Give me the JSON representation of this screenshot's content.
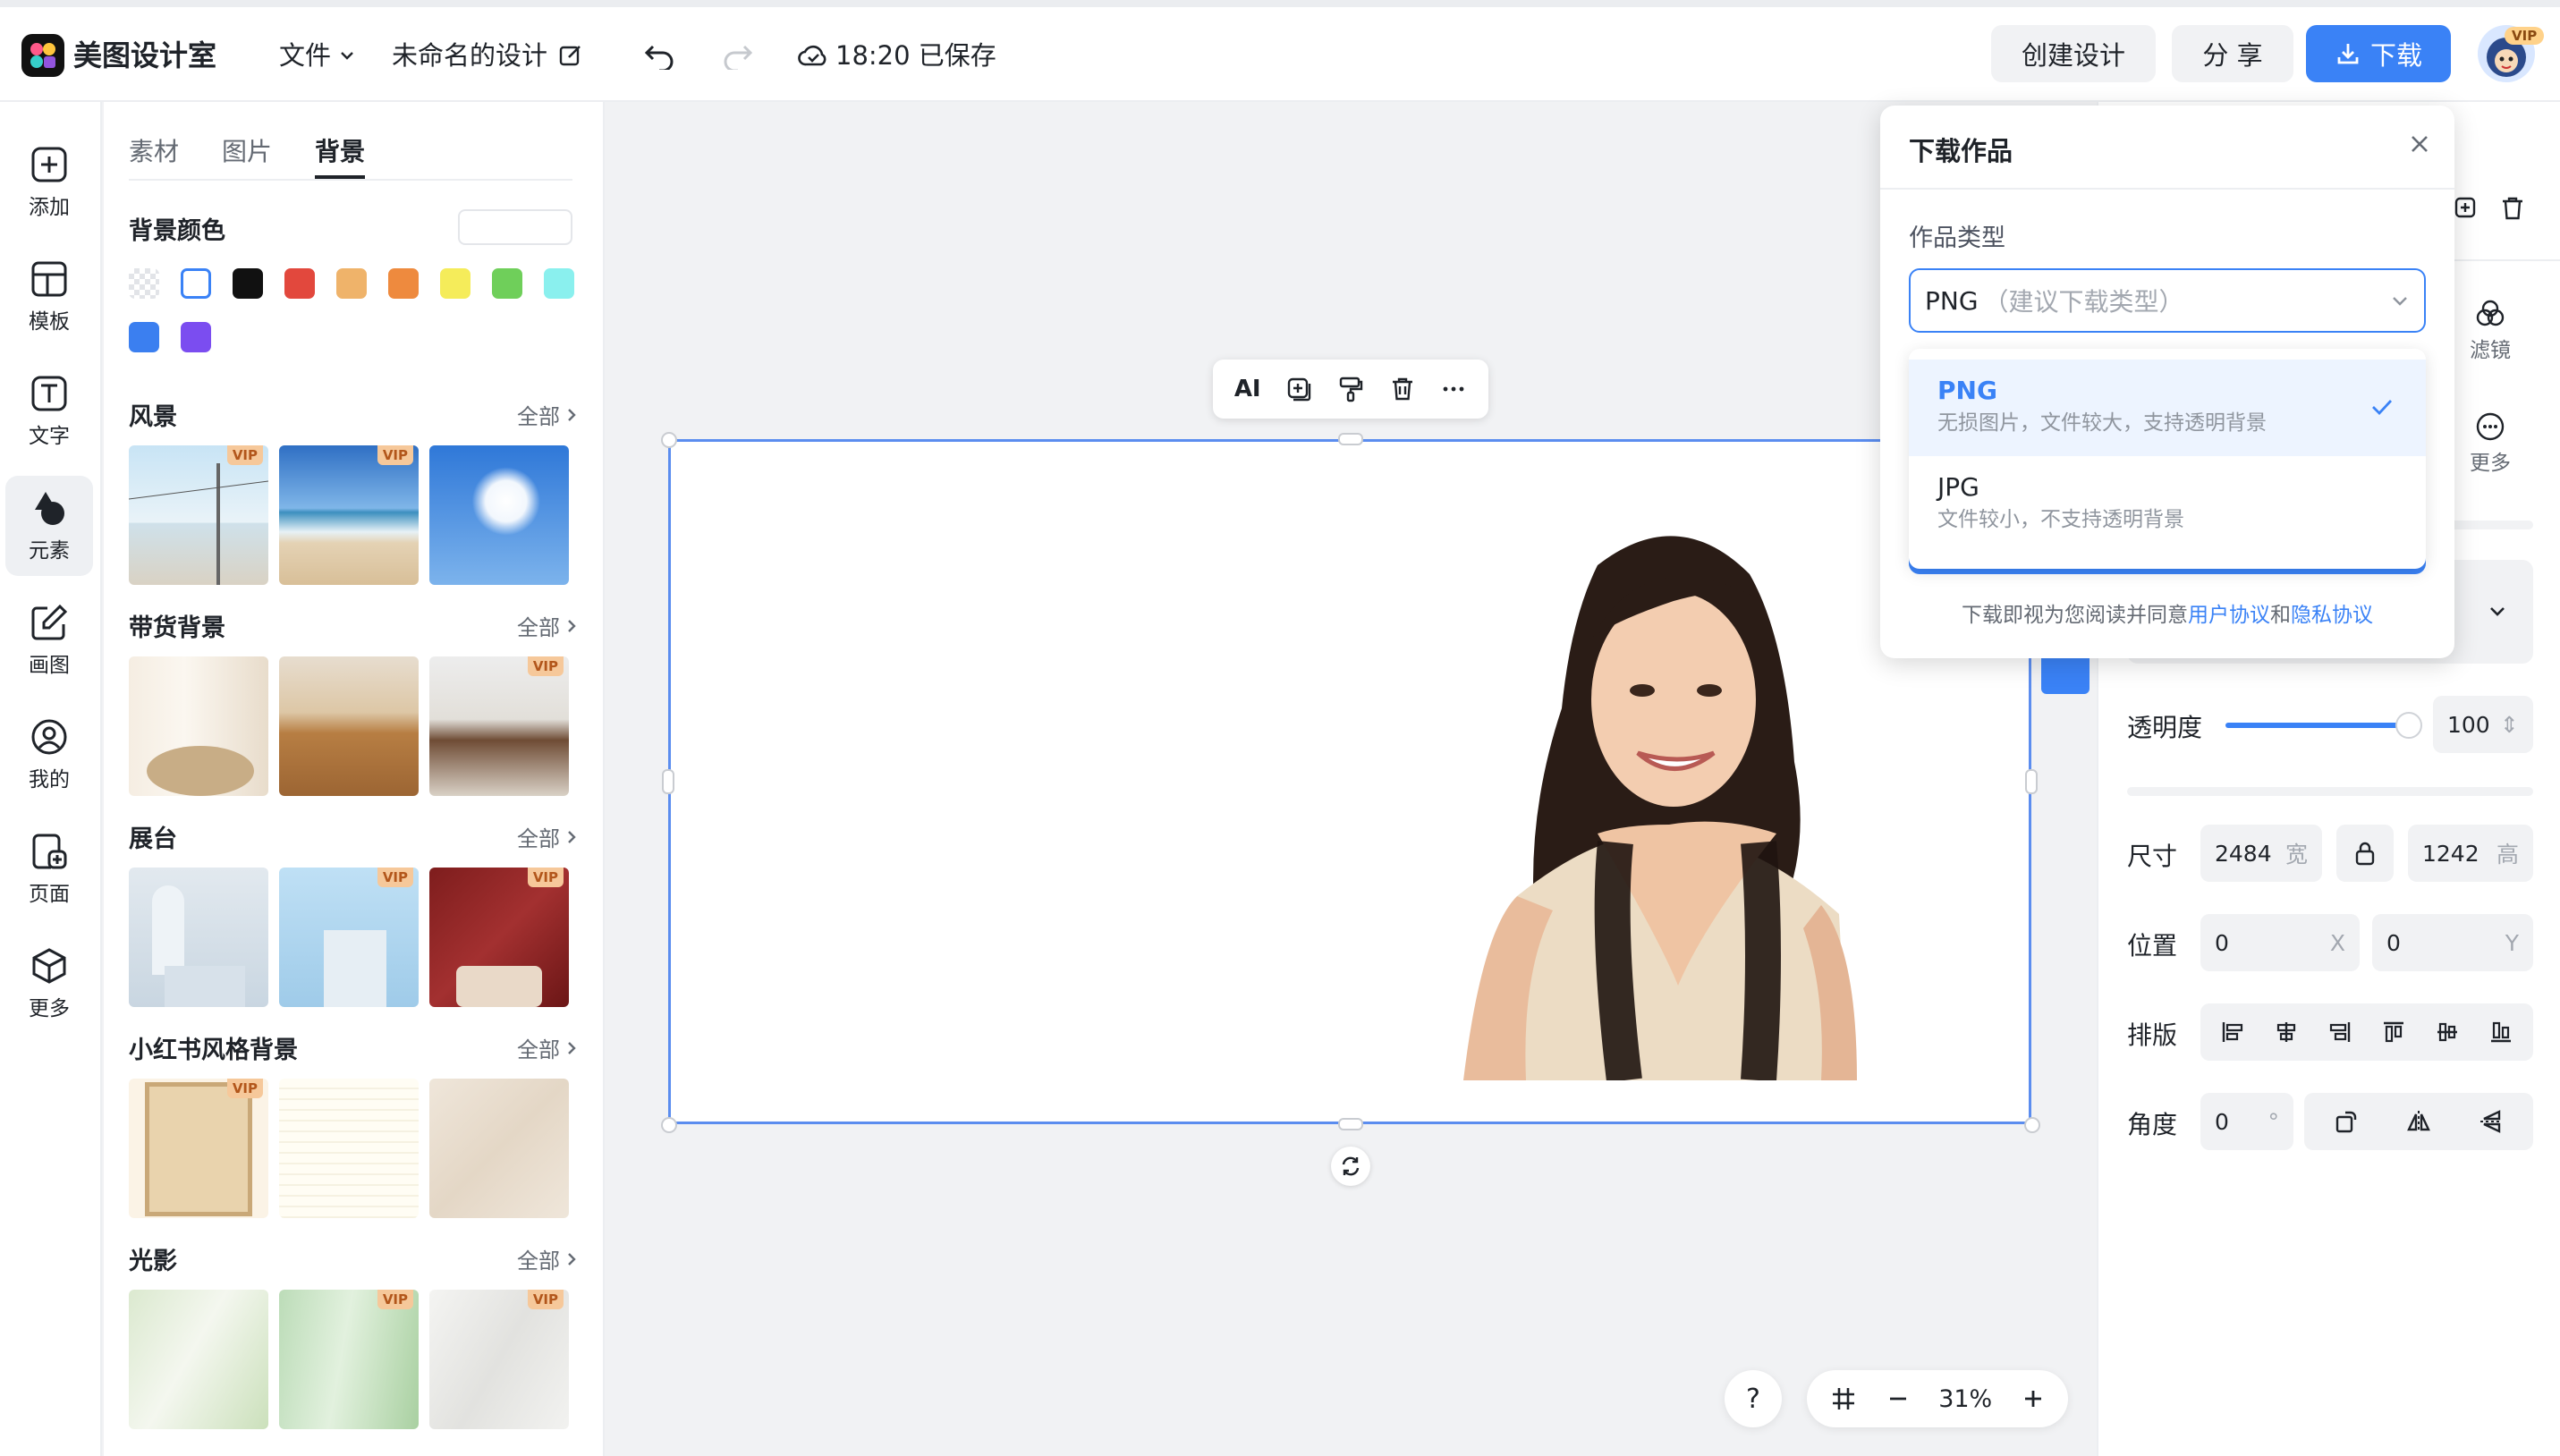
{
  "header": {
    "app_name": "美图设计室",
    "file_menu": "文件",
    "doc_title": "未命名的设计",
    "save_status": "18:20 已保存",
    "create_label": "创建设计",
    "share_label": "分 享",
    "download_label": "下载",
    "avatar_badge": "VIP"
  },
  "left_nav": {
    "items": [
      {
        "label": "添加",
        "icon": "plus-square-icon"
      },
      {
        "label": "模板",
        "icon": "template-icon"
      },
      {
        "label": "文字",
        "icon": "text-icon"
      },
      {
        "label": "元素",
        "icon": "shapes-icon"
      },
      {
        "label": "画图",
        "icon": "edit-icon"
      },
      {
        "label": "我的",
        "icon": "user-icon"
      },
      {
        "label": "页面",
        "icon": "page-add-icon"
      },
      {
        "label": "更多",
        "icon": "cube-icon"
      }
    ],
    "active_index": 3
  },
  "panel": {
    "tabs": [
      "素材",
      "图片",
      "背景"
    ],
    "active_tab": 2,
    "bg_color_title": "背景颜色",
    "colors": [
      "transparent",
      "#ffffff",
      "#111111",
      "#e2483d",
      "#efb36a",
      "#ee8a3e",
      "#f5ec5a",
      "#6fcf5a",
      "#8af0ee",
      "#3b7ff0",
      "#7b4df0"
    ],
    "sections": [
      {
        "title": "风景",
        "all": "全部"
      },
      {
        "title": "带货背景",
        "all": "全部"
      },
      {
        "title": "展台",
        "all": "全部"
      },
      {
        "title": "小红书风格背景",
        "all": "全部"
      },
      {
        "title": "光影",
        "all": "全部"
      }
    ],
    "vip_label": "VIP"
  },
  "float_toolbar": {
    "ai_label": "AI"
  },
  "right_panel": {
    "filter_label": "滤镜",
    "more_label": "更多",
    "opacity_label": "透明度",
    "opacity_value": "100",
    "size_label": "尺寸",
    "width_value": "2484",
    "width_unit": "宽",
    "height_value": "1242",
    "height_unit": "高",
    "position_label": "位置",
    "x_value": "0",
    "x_unit": "X",
    "y_value": "0",
    "y_unit": "Y",
    "arrange_label": "排版",
    "angle_label": "角度",
    "angle_value": "0",
    "angle_unit": "°"
  },
  "download_dialog": {
    "title": "下载作品",
    "type_label": "作品类型",
    "selected_value": "PNG",
    "selected_hint": "（建议下载类型）",
    "options": [
      {
        "name": "PNG",
        "desc": "无损图片，文件较大，支持透明背景"
      },
      {
        "name": "JPG",
        "desc": "文件较小，不支持透明背景"
      }
    ],
    "agreement_prefix": "下载即视为您阅读并同意",
    "user_agreement": "用户协议",
    "and": "和",
    "privacy_policy": "隐私协议"
  },
  "zoom": {
    "help": "?",
    "value": "31%"
  },
  "colors": {
    "accent": "#3a82f6",
    "selection": "#5b8def"
  }
}
